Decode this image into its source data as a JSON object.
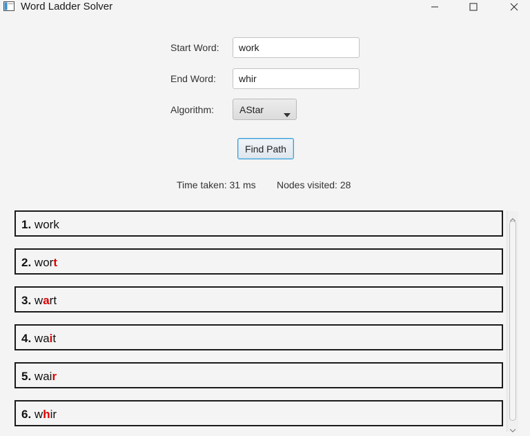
{
  "window": {
    "title": "Word Ladder Solver",
    "controls": [
      "minimize-icon",
      "maximize-icon",
      "close-icon"
    ]
  },
  "form": {
    "start_label": "Start Word:",
    "start_value": "work",
    "end_label": "End Word:",
    "end_value": "whir",
    "algorithm_label": "Algorithm:",
    "algorithm_value": "AStar",
    "find_button": "Find Path"
  },
  "stats": {
    "time_text": "Time taken: 31 ms",
    "nodes_text": "Nodes visited: 28"
  },
  "results": [
    {
      "num": "1.",
      "pre": "work",
      "changed": "",
      "post": ""
    },
    {
      "num": "2.",
      "pre": "wor",
      "changed": "t",
      "post": ""
    },
    {
      "num": "3.",
      "pre": "w",
      "changed": "a",
      "post": "rt"
    },
    {
      "num": "4.",
      "pre": "wa",
      "changed": "i",
      "post": "t"
    },
    {
      "num": "5.",
      "pre": "wai",
      "changed": "r",
      "post": ""
    },
    {
      "num": "6.",
      "pre": "w",
      "changed": "h",
      "post": "ir"
    }
  ],
  "colors": {
    "changed_letter": "#e00000",
    "button_focus": "#3c9fd8",
    "row_border": "#1a1a1a"
  }
}
